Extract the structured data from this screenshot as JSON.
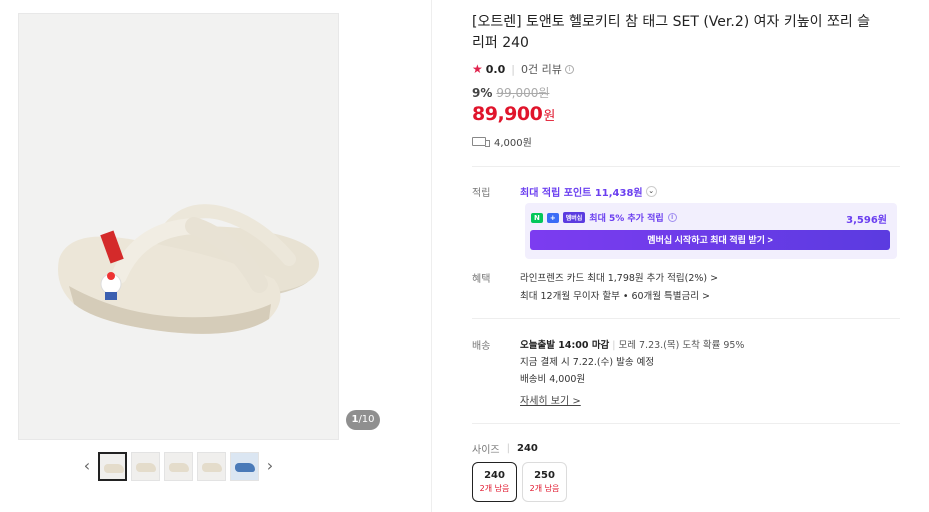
{
  "gallery": {
    "counter_current": "1",
    "counter_total": "/10",
    "prev_icon": "chevron-left-icon",
    "next_icon": "chevron-right-icon",
    "thumb_count": 5
  },
  "product": {
    "title": "[오트렌] 토앤토 헬로키티 참 태그 SET (Ver.2) 여자 키높이 쪼리 슬리퍼 240",
    "rating": "0.0",
    "reviews": "0건 리뷰",
    "discount_rate": "9%",
    "original_price": "99,000원",
    "price": "89,900",
    "price_unit": "원",
    "shipping_fee_short": "4,000원"
  },
  "points": {
    "label": "적립",
    "max_points": "최대 적립 포인트 11,438원",
    "membership": {
      "npay": "N",
      "plus": "+",
      "badge": "멤버십",
      "text": "최대 5% 추가 적립",
      "amount": "3,596원",
      "button": "멤버십 시작하고 최대 적립 받기 >"
    }
  },
  "benefits": {
    "label": "혜택",
    "line1": "라인프렌즈 카드 최대 1,798원 추가 적립(2%) >",
    "line2": "최대 12개월 무이자 할부 • 60개월 특별금리 >"
  },
  "delivery": {
    "label": "배송",
    "today_label": "오늘출발 14:00 마감",
    "arrival": "모레 7.23.(목) 도착 확률 95%",
    "dispatch": "지금 결제 시 7.22.(수) 발송 예정",
    "fee": "배송비 4,000원",
    "detail": "자세히 보기 >"
  },
  "size": {
    "label": "사이즈",
    "selected": "240",
    "options": [
      {
        "value": "240",
        "stock": "2개 남음"
      },
      {
        "value": "250",
        "stock": "2개 남음"
      }
    ]
  },
  "colors": {
    "price_red": "#e0142b",
    "accent_purple": "#6b3ff0",
    "star": "#e0234d"
  }
}
